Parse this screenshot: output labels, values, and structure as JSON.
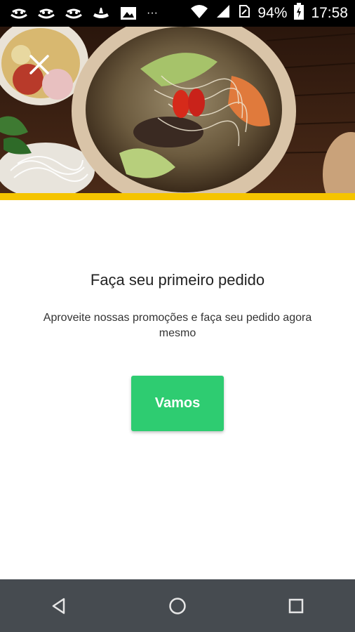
{
  "status_bar": {
    "notification_icons": [
      "notification-icon",
      "notification-icon",
      "notification-icon",
      "notification-icon",
      "image-icon",
      "more-icon"
    ],
    "more_label": "···",
    "battery_percent": "94%",
    "time": "17:58",
    "background": "#000000"
  },
  "hero": {
    "accent_color": "#f5c400"
  },
  "content": {
    "title": "Faça seu primeiro pedido",
    "subtitle": "Aproveite nossas promoções e faça seu pedido agora mesmo",
    "cta_label": "Vamos",
    "cta_color": "#2ecc71"
  },
  "nav_bar": {
    "background": "#464b50",
    "buttons": [
      "back-icon",
      "home-icon",
      "recents-icon"
    ]
  }
}
